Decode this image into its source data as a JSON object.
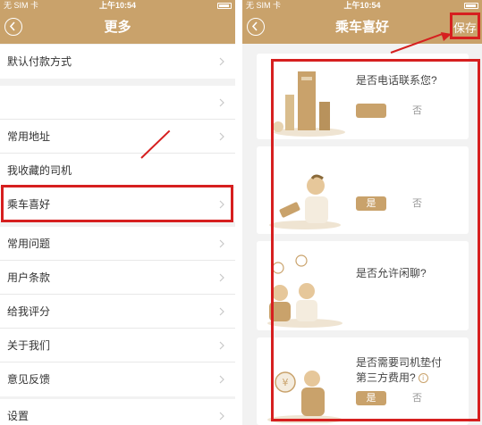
{
  "left": {
    "status": {
      "carrier": "无 SIM 卡",
      "time": "上午10:54"
    },
    "nav": {
      "title": "更多"
    },
    "items": [
      {
        "label": "默认付款方式"
      },
      {
        "label": ""
      },
      {
        "label": "常用地址"
      },
      {
        "label": "我收藏的司机"
      },
      {
        "label": "乘车喜好"
      },
      {
        "label": "常用问题"
      },
      {
        "label": "用户条款"
      },
      {
        "label": "给我评分"
      },
      {
        "label": "关于我们"
      },
      {
        "label": "意见反馈"
      },
      {
        "label": "设置"
      }
    ]
  },
  "right": {
    "status": {
      "carrier": "无 SIM 卡",
      "time": "上午10:54"
    },
    "nav": {
      "title": "乘车喜好",
      "save_label": "保存"
    },
    "cards": [
      {
        "question": "是否电话联系您?",
        "yes": "",
        "no": "否"
      },
      {
        "question": "",
        "yes": "是",
        "no": "否"
      },
      {
        "question": "是否允许闲聊?",
        "yes": "",
        "no": ""
      },
      {
        "question_line1": "是否需要司机垫付",
        "question_line2": "第三方费用?",
        "yes": "是",
        "no": "否"
      }
    ]
  },
  "colors": {
    "brand": "#c9a26b",
    "annotation": "#d61f1f",
    "background": "#f2f2f2"
  }
}
